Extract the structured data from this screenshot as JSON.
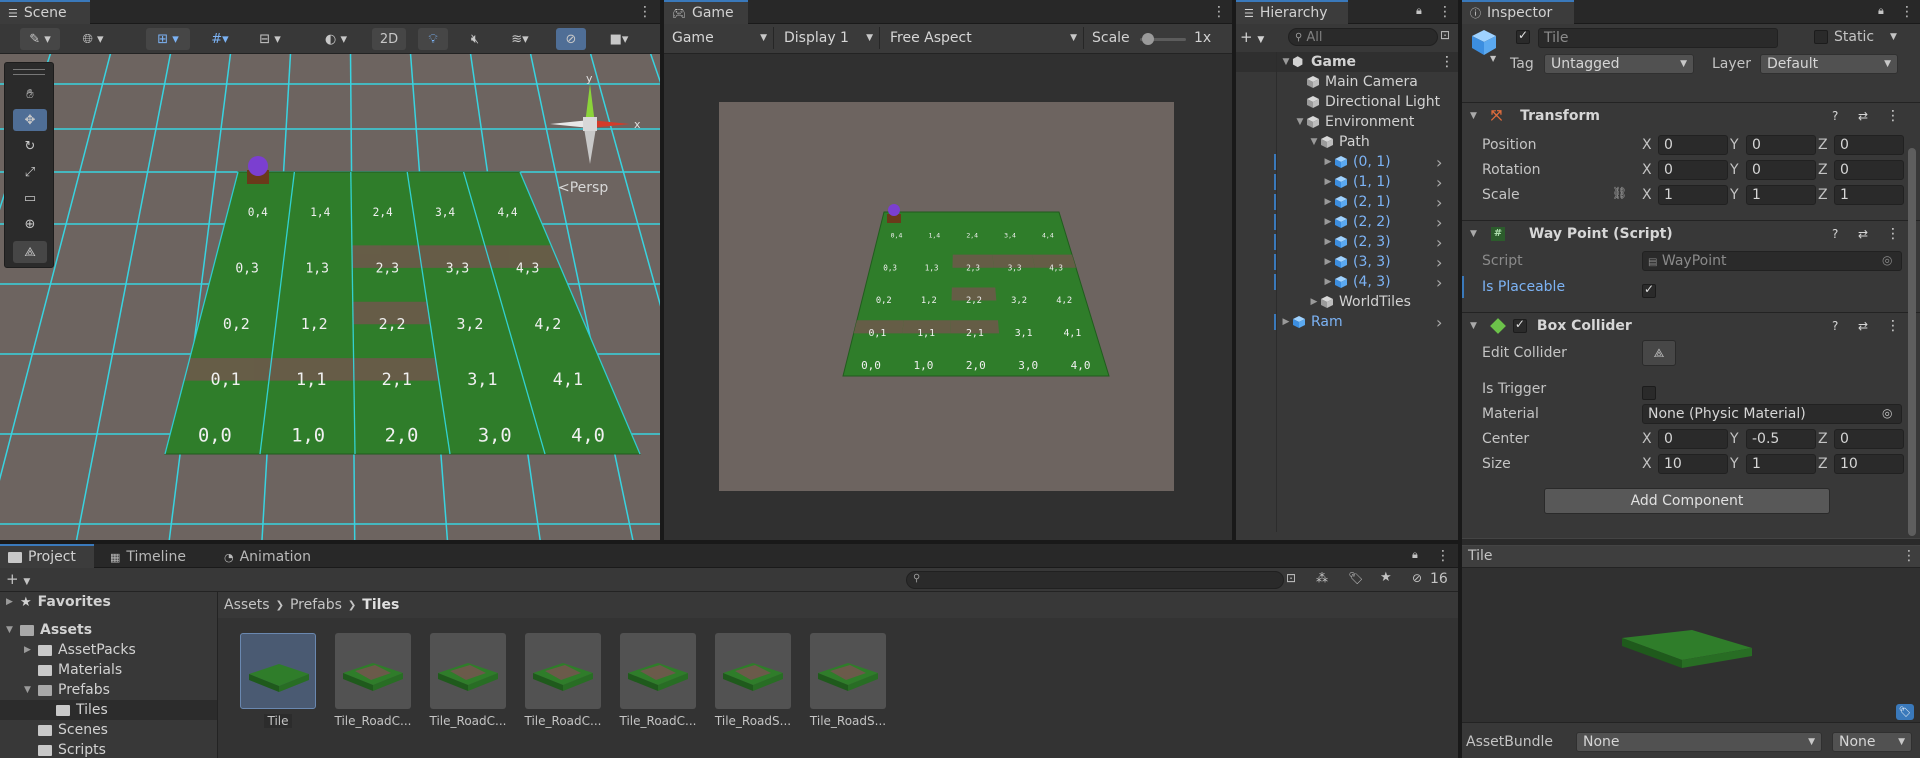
{
  "scene": {
    "tab": "Scene",
    "btn_2d": "2D",
    "persp": "<Persp",
    "axis_x": "x",
    "axis_y": "y",
    "tiles": [
      [
        "0,4",
        "1,4",
        "2,4",
        "3,4",
        "4,4"
      ],
      [
        "0,3",
        "1,3",
        "2,3",
        "3,3",
        "4,3"
      ],
      [
        "0,2",
        "1,2",
        "2,2",
        "3,2",
        "4,2"
      ],
      [
        "0,1",
        "1,1",
        "2,1",
        "3,1",
        "4,1"
      ],
      [
        "0,0",
        "1,0",
        "2,0",
        "3,0",
        "4,0"
      ]
    ]
  },
  "game": {
    "tab": "Game",
    "mode": "Game",
    "display": "Display 1",
    "aspect": "Free Aspect",
    "scale_label": "Scale",
    "scale_value": "1x",
    "tiles": [
      [
        "0,4",
        "1,4",
        "2,4",
        "3,4",
        "4,4"
      ],
      [
        "0,3",
        "1,3",
        "2,3",
        "3,3",
        "4,3"
      ],
      [
        "0,2",
        "1,2",
        "2,2",
        "3,2",
        "4,2"
      ],
      [
        "0,1",
        "1,1",
        "2,1",
        "3,1",
        "4,1"
      ],
      [
        "0,0",
        "1,0",
        "2,0",
        "3,0",
        "4,0"
      ]
    ]
  },
  "hierarchy": {
    "tab": "Hierarchy",
    "search_placeholder": "All",
    "items": [
      {
        "label": "Game",
        "depth": 0,
        "tri": "▼",
        "bold": true,
        "blue": false
      },
      {
        "label": "Main Camera",
        "depth": 1,
        "tri": "",
        "bold": false,
        "blue": false
      },
      {
        "label": "Directional Light",
        "depth": 1,
        "tri": "",
        "bold": false,
        "blue": false
      },
      {
        "label": "Environment",
        "depth": 1,
        "tri": "▼",
        "bold": false,
        "blue": false
      },
      {
        "label": "Path",
        "depth": 2,
        "tri": "▼",
        "bold": false,
        "blue": false
      },
      {
        "label": "(0, 1)",
        "depth": 3,
        "tri": "▶",
        "bold": false,
        "blue": true
      },
      {
        "label": "(1, 1)",
        "depth": 3,
        "tri": "▶",
        "bold": false,
        "blue": true
      },
      {
        "label": "(2, 1)",
        "depth": 3,
        "tri": "▶",
        "bold": false,
        "blue": true
      },
      {
        "label": "(2, 2)",
        "depth": 3,
        "tri": "▶",
        "bold": false,
        "blue": true
      },
      {
        "label": "(2, 3)",
        "depth": 3,
        "tri": "▶",
        "bold": false,
        "blue": true
      },
      {
        "label": "(3, 3)",
        "depth": 3,
        "tri": "▶",
        "bold": false,
        "blue": true
      },
      {
        "label": "(4, 3)",
        "depth": 3,
        "tri": "▶",
        "bold": false,
        "blue": true
      },
      {
        "label": "WorldTiles",
        "depth": 2,
        "tri": "▶",
        "bold": false,
        "blue": false
      },
      {
        "label": "Ram",
        "depth": 0,
        "tri": "▶",
        "bold": false,
        "blue": true
      }
    ]
  },
  "inspector": {
    "tab": "Inspector",
    "object_name": "Tile",
    "static_label": "Static",
    "tag_label": "Tag",
    "tag_value": "Untagged",
    "layer_label": "Layer",
    "layer_value": "Default",
    "transform": {
      "title": "Transform",
      "position": {
        "label": "Position",
        "x": "0",
        "y": "0",
        "z": "0"
      },
      "rotation": {
        "label": "Rotation",
        "x": "0",
        "y": "0",
        "z": "0"
      },
      "scale": {
        "label": "Scale",
        "x": "1",
        "y": "1",
        "z": "1"
      }
    },
    "waypoint": {
      "title": "Way Point (Script)",
      "script_label": "Script",
      "script_value": "WayPoint",
      "placeable_label": "Is Placeable"
    },
    "collider": {
      "title": "Box Collider",
      "edit_label": "Edit Collider",
      "trigger_label": "Is Trigger",
      "material_label": "Material",
      "material_value": "None (Physic Material)",
      "center": {
        "label": "Center",
        "x": "0",
        "y": "-0.5",
        "z": "0"
      },
      "size": {
        "label": "Size",
        "x": "10",
        "y": "1",
        "z": "10"
      }
    },
    "add_component": "Add Component",
    "preview_title": "Tile",
    "assetbundle_label": "AssetBundle",
    "assetbundle_value": "None",
    "assetbundle_variant": "None",
    "axes": {
      "x": "X",
      "y": "Y",
      "z": "Z"
    }
  },
  "project": {
    "tabs": [
      "Project",
      "Timeline",
      "Animation"
    ],
    "hidden_count": "16",
    "tree": [
      {
        "label": "Favorites",
        "depth": 0,
        "tri": "▶",
        "icon": "star"
      },
      {
        "label": "Assets",
        "depth": 0,
        "tri": "▼",
        "icon": "folder-open"
      },
      {
        "label": "AssetPacks",
        "depth": 1,
        "tri": "▶",
        "icon": "folder"
      },
      {
        "label": "Materials",
        "depth": 1,
        "tri": "",
        "icon": "folder"
      },
      {
        "label": "Prefabs",
        "depth": 1,
        "tri": "▼",
        "icon": "folder-open"
      },
      {
        "label": "Tiles",
        "depth": 2,
        "tri": "",
        "icon": "folder"
      },
      {
        "label": "Scenes",
        "depth": 1,
        "tri": "",
        "icon": "folder"
      },
      {
        "label": "Scripts",
        "depth": 1,
        "tri": "",
        "icon": "folder"
      }
    ],
    "breadcrumb": [
      "Assets",
      "Prefabs",
      "Tiles"
    ],
    "assets": [
      "Tile",
      "Tile_RoadC...",
      "Tile_RoadC...",
      "Tile_RoadC...",
      "Tile_RoadC...",
      "Tile_RoadS...",
      "Tile_RoadS..."
    ]
  },
  "colors": {
    "grass": "#2f7d2a",
    "road": "#6b5a4a",
    "accent": "#3a79bb",
    "grid": "#33e0ee",
    "link": "#7cb3f5"
  }
}
